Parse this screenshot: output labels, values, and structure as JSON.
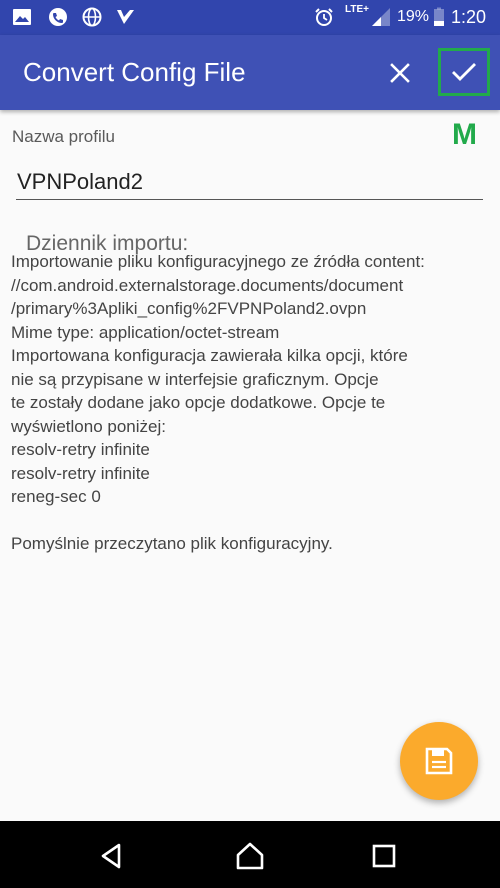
{
  "status_bar": {
    "icons": [
      "image-icon",
      "phone-icon",
      "globe-icon",
      "checkmark-app-icon",
      "alarm-icon",
      "signal-icon",
      "battery-icon"
    ],
    "network": "LTE+",
    "battery": "19%",
    "time": "1:20"
  },
  "appbar": {
    "title": "Convert Config File",
    "close_icon": "close-icon",
    "confirm_icon": "check-icon",
    "background": "#3f51b5",
    "highlight_color": "#22aa4b"
  },
  "marker": "M",
  "profile": {
    "label": "Nazwa profilu",
    "value": "VPNPoland2"
  },
  "log": {
    "title": "Dziennik importu:",
    "lines": [
      "Importowanie pliku konfiguracyjnego ze źródła content:",
      "//com.android.externalstorage.documents/document",
      "/primary%3Apliki_config%2FVPNPoland2.ovpn",
      "Mime type: application/octet-stream",
      "Importowana konfiguracja zawierała kilka opcji, które",
      "nie są przypisane w interfejsie graficznym. Opcje",
      "te zostały dodane jako opcje dodatkowe. Opcje te",
      "wyświetlono poniżej:",
      "resolv-retry infinite",
      "resolv-retry infinite",
      "reneg-sec 0",
      "",
      "Pomyślnie przeczytano plik konfiguracyjny."
    ]
  },
  "fab": {
    "icon": "save-icon",
    "color": "#fbaa2c"
  },
  "navbar": {
    "icons": [
      "back-icon",
      "home-icon",
      "recents-icon"
    ]
  }
}
